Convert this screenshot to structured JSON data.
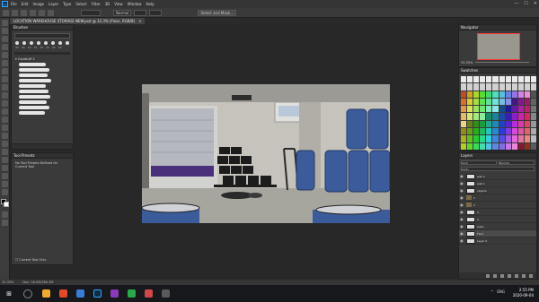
{
  "menubar": {
    "items": [
      "File",
      "Edit",
      "Image",
      "Layer",
      "Type",
      "Select",
      "Filter",
      "3D",
      "View",
      "Window",
      "Help"
    ]
  },
  "options": {
    "mode_label": "Normal",
    "select_mask_label": "Select and Mask..."
  },
  "document": {
    "tab_title": "LOCATION WAREHOUSE STORAGE NEW.psd @ 33.3% (Floor, RGB/8)",
    "close_glyph": "×"
  },
  "panels": {
    "brushes_title": "Brushes",
    "brush_sizes": [
      "30",
      "45",
      "50",
      "25",
      "30",
      "25",
      "45",
      "50"
    ],
    "brush_folder": "Coolstuff 2",
    "tool_presets_title": "Tool Presets",
    "tool_presets_empty": "No Tool Presets Defined for Current Tool",
    "current_tool_only": "Current Tool Only",
    "navigator_title": "Navigator",
    "navigator_zoom": "33.33%",
    "swatches_title": "Swatches",
    "layers_title": "Layers",
    "layers_kind": "Kind",
    "layers_blend": "Normal",
    "layers_lock": "Lock:"
  },
  "layers": [
    {
      "name": "wall 2",
      "type": "layer",
      "visible": true
    },
    {
      "name": "wall 1",
      "type": "layer",
      "visible": true
    },
    {
      "name": "objects",
      "type": "layer",
      "visible": true
    },
    {
      "name": "1",
      "type": "group",
      "visible": true
    },
    {
      "name": "2",
      "type": "group",
      "visible": true
    },
    {
      "name": "3",
      "type": "layer",
      "visible": true
    },
    {
      "name": "4",
      "type": "layer",
      "visible": true
    },
    {
      "name": "walls",
      "type": "layer",
      "visible": true
    },
    {
      "name": "Floor",
      "type": "layer",
      "visible": true,
      "selected": true
    },
    {
      "name": "Layer 0",
      "type": "layer",
      "visible": true
    }
  ],
  "status": {
    "zoom": "33.33%",
    "doc": "Doc: 18.0M/360.2M"
  },
  "taskbar": {
    "time": "2:55 PM",
    "date": "2020-09-04",
    "lang": "ENG"
  },
  "colors": {
    "barrel_blue": "#3b5b9a",
    "door_purple": "#4a2f7a",
    "tire_black": "#1c1c1c",
    "accent": "#31a8ff"
  }
}
